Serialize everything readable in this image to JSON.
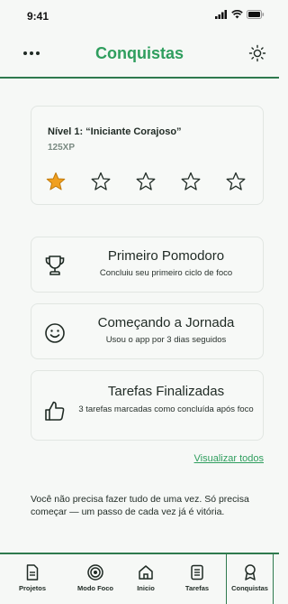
{
  "status_bar": {
    "time": "9:41"
  },
  "header": {
    "title": "Conquistas"
  },
  "level": {
    "title": "Nível 1: “Iniciante Corajoso”",
    "xp": "125XP",
    "stars_filled": 1,
    "stars_total": 5,
    "star_color": "#f0a020"
  },
  "achievements": [
    {
      "icon": "trophy-icon",
      "title": "Primeiro Pomodoro",
      "desc": "Concluiu seu primeiro ciclo de foco"
    },
    {
      "icon": "smile-icon",
      "title": "Começando a Jornada",
      "desc": "Usou o app por 3 dias seguidos"
    },
    {
      "icon": "thumbs-up-icon",
      "title": "Tarefas Finalizadas",
      "desc": "3 tarefas marcadas como concluída após foco"
    }
  ],
  "view_all": "Visualizar todos",
  "quote": "Você não precisa fazer tudo de uma vez. Só precisa começar — um passo de cada vez já é vitória.",
  "nav": [
    {
      "label": "Projetos",
      "icon": "document-icon"
    },
    {
      "label": "Modo Foco",
      "icon": "target-icon"
    },
    {
      "label": "Inicio",
      "icon": "home-icon"
    },
    {
      "label": "Tarefas",
      "icon": "list-icon"
    },
    {
      "label": "Conquistas",
      "icon": "ribbon-icon",
      "active": true
    }
  ],
  "colors": {
    "accent": "#2f9e5e",
    "divider": "#2f7a4e",
    "star": "#f0a020"
  }
}
